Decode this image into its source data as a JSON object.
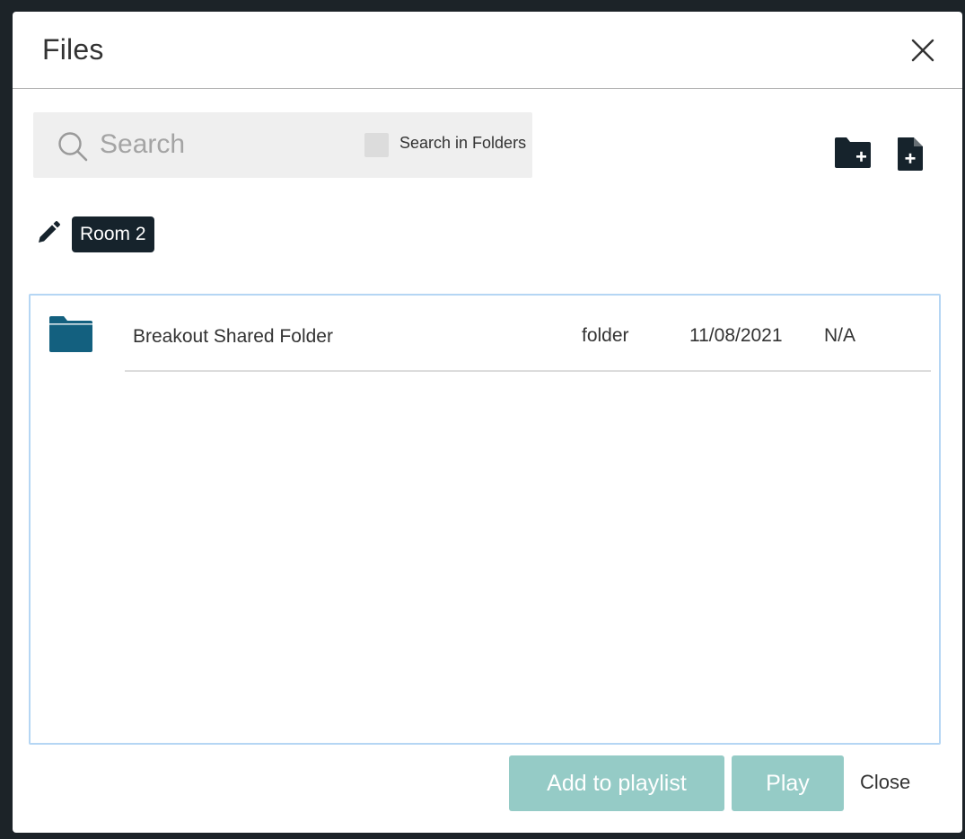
{
  "dialog": {
    "title": "Files",
    "close_icon": "close-icon"
  },
  "search": {
    "placeholder": "Search",
    "value": "",
    "icon": "search-icon",
    "in_folders_label": "Search in Folders",
    "in_folders_checked": false
  },
  "toolbar": {
    "new_folder_icon": "folder-plus-icon",
    "new_file_icon": "file-plus-icon"
  },
  "breadcrumb": {
    "edit_icon": "pencil-icon",
    "current": "Room 2"
  },
  "files": [
    {
      "icon": "folder-icon",
      "name": "Breakout Shared Folder",
      "type": "folder",
      "date": "11/08/2021",
      "size": "N/A"
    }
  ],
  "footer": {
    "add_to_playlist_label": "Add to playlist",
    "play_label": "Play",
    "close_label": "Close"
  },
  "colors": {
    "backdrop": "#1c2328",
    "accent_disabled": "#95cbc6",
    "folder_icon": "#13607f",
    "breadcrumb_chip": "#16232c",
    "list_border": "#b5d6f4"
  }
}
